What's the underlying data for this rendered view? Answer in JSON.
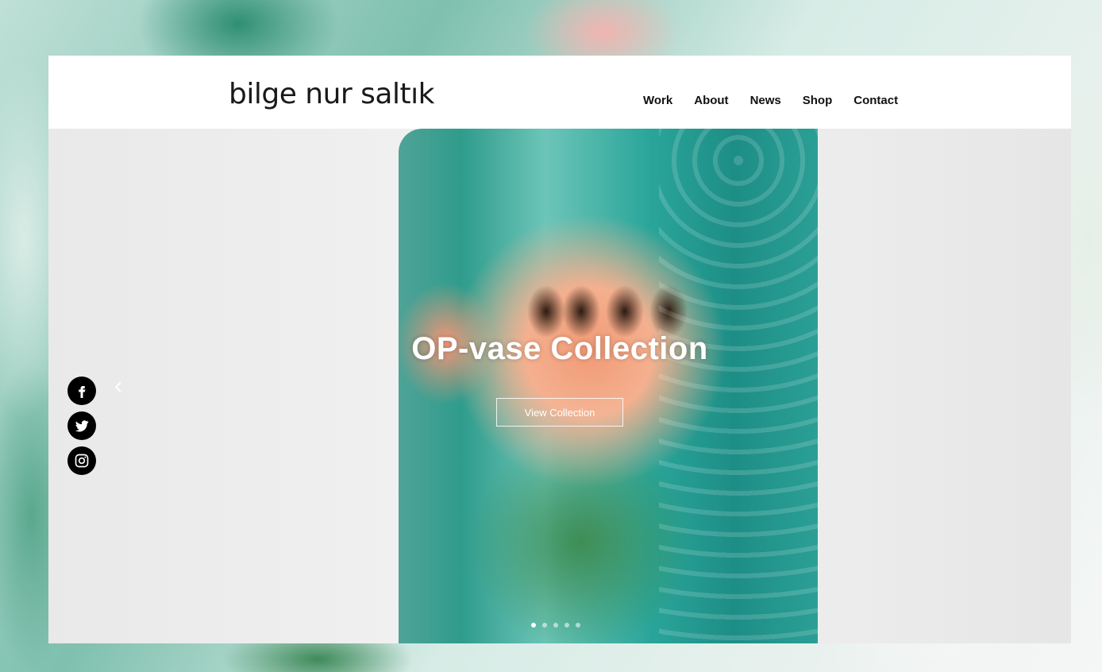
{
  "site": {
    "logo_text": "bilge nur saltık"
  },
  "nav": {
    "items": [
      "Work",
      "About",
      "News",
      "Shop",
      "Contact"
    ]
  },
  "hero": {
    "title": "OP-vase Collection",
    "button_label": "View Collection",
    "slide_count": 5,
    "active_slide": 1
  },
  "social": {
    "icons": [
      "facebook-icon",
      "twitter-icon",
      "instagram-icon"
    ]
  },
  "colors": {
    "header_bg": "#ffffff",
    "text": "#111111",
    "hero_text": "#ffffff",
    "social_bg": "#000000"
  }
}
